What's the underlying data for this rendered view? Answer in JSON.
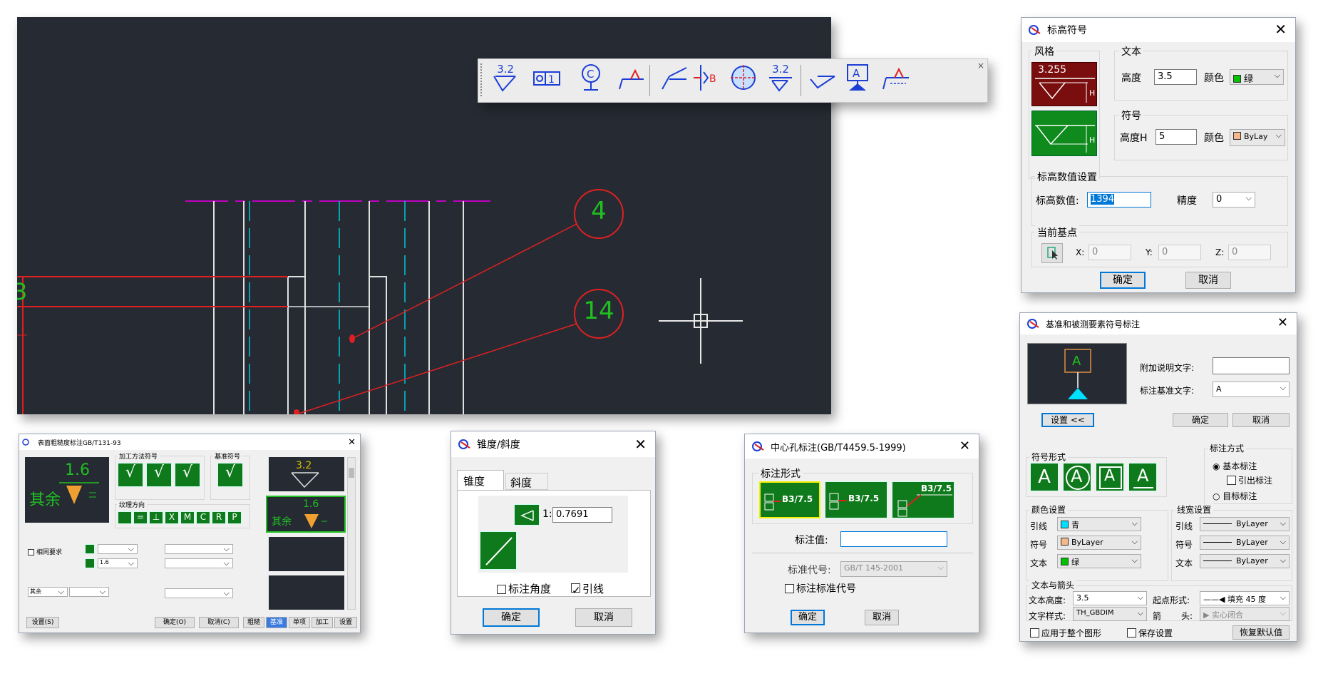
{
  "canvas": {
    "balloon1": "4",
    "balloon2": "14",
    "side_mark": "3"
  },
  "toolbar": {
    "icons": [
      {
        "name": "surface-roughness-icon",
        "label": "3.2"
      },
      {
        "name": "datum-target-icon",
        "label": "O1"
      },
      {
        "name": "center-c-icon",
        "label": "C"
      },
      {
        "name": "weld-symbol-icon",
        "label": ""
      },
      {
        "name": "leader-icon",
        "label": ""
      },
      {
        "name": "datum-b-icon",
        "label": "B"
      },
      {
        "name": "centerline-circle-icon",
        "label": ""
      },
      {
        "name": "roughness-removal-icon",
        "label": "3.2"
      },
      {
        "name": "check-mark-icon",
        "label": ""
      },
      {
        "name": "datum-a-icon",
        "label": "A"
      },
      {
        "name": "weld-leader-icon",
        "label": ""
      }
    ],
    "close": "×"
  },
  "elevation": {
    "title": "标高符号",
    "style_group": "风格",
    "style_value": "3.255",
    "style_h": "H",
    "text_group": "文本",
    "text_height_label": "高度",
    "text_height": "3.5",
    "text_color_label": "颜色",
    "text_color": "绿",
    "symbol_group": "符号",
    "symbol_height_label": "高度H",
    "symbol_height": "5",
    "symbol_color_label": "颜色",
    "symbol_color": "ByLay",
    "value_group": "标高数值设置",
    "value_label": "标高数值:",
    "value": "1394",
    "precision_label": "精度",
    "precision": "0",
    "base_group": "当前基点",
    "x_label": "X:",
    "x": "0",
    "y_label": "Y:",
    "y": "0",
    "z_label": "Z:",
    "z": "0",
    "ok": "确定",
    "cancel": "取消",
    "colors": {
      "green": "#00c000",
      "bylayer": "#f5b88a"
    }
  },
  "datum": {
    "title": "基准和被测要素符号标注",
    "preview_letter": "A",
    "extra_text_label": "附加说明文字:",
    "extra_text": "",
    "datum_text_label": "标注基准文字:",
    "datum_text": "A",
    "settings_btn": "设置 <<",
    "ok": "确定",
    "cancel": "取消",
    "form_group": "符号形式",
    "forms": [
      "A",
      "A",
      "A",
      "A"
    ],
    "mode_group": "标注方式",
    "mode_basic": "基本标注",
    "mode_leader": "引出标注",
    "mode_target": "目标标注",
    "color_group": "颜色设置",
    "color_leader_label": "引线",
    "color_leader": "青",
    "color_symbol_label": "符号",
    "color_symbol": "ByLayer",
    "color_text_label": "文本",
    "color_text": "绿",
    "lw_group": "线宽设置",
    "lw_leader_label": "引线",
    "lw_leader": "ByLayer",
    "lw_symbol_label": "符号",
    "lw_symbol": "ByLayer",
    "lw_text_label": "文本",
    "lw_text": "ByLayer",
    "ta_group": "文本与箭头",
    "text_height_label": "文本高度:",
    "text_height": "3.5",
    "start_label": "起点形式:",
    "start_value": "填充 45 度",
    "text_style_label": "文字样式:",
    "text_style": "TH_GBDIM",
    "arrow_label": "箭",
    "head_label": "头:",
    "head_value": "实心闭合",
    "apply_all": "应用于整个图形",
    "save_settings": "保存设置",
    "restore_default": "恢复默认值",
    "colors": {
      "cyan": "#00e0ff",
      "bylayer": "#f5b88a",
      "green": "#00c000"
    }
  },
  "roughness": {
    "title": "表面粗糙度标注GB/T131-93",
    "preview_value": "1.6",
    "preview_text": "其余",
    "group1": "加工方法符号",
    "group2": "基准符号",
    "group3": "纹理方向",
    "dir_buttons": [
      "=",
      "⊥",
      "X",
      "M",
      "C",
      "R",
      "P"
    ],
    "same_req_label": "相同要求",
    "combo_value": "1.6",
    "small_combo": "其余",
    "side_value1": "3.2",
    "side_value2": "1.6",
    "side_text": "其余",
    "settings": "设置(S)",
    "ok": "确定(O)",
    "cancel": "取消(C)",
    "bottom_tabs": [
      "粗糙",
      "基准",
      "单项",
      "加工",
      "设置"
    ]
  },
  "taper": {
    "title": "锥度/斜度",
    "tab1": "锥度",
    "tab2": "斜度",
    "ratio_prefix": "1:",
    "ratio": "0.7691",
    "angle_label": "标注角度",
    "leader_label": "引线",
    "ok": "确定",
    "cancel": "取消"
  },
  "center": {
    "title": "中心孔标注(GB/T4459.5-1999)",
    "group": "标注形式",
    "forms": [
      "B3/7.5",
      "B3/7.5",
      "B3/7.5"
    ],
    "value_label": "标注值:",
    "value": "",
    "std_label": "标准代号:",
    "std_value": "GB/T 145-2001",
    "std_check": "标注标准代号",
    "ok": "确定",
    "cancel": "取消"
  }
}
